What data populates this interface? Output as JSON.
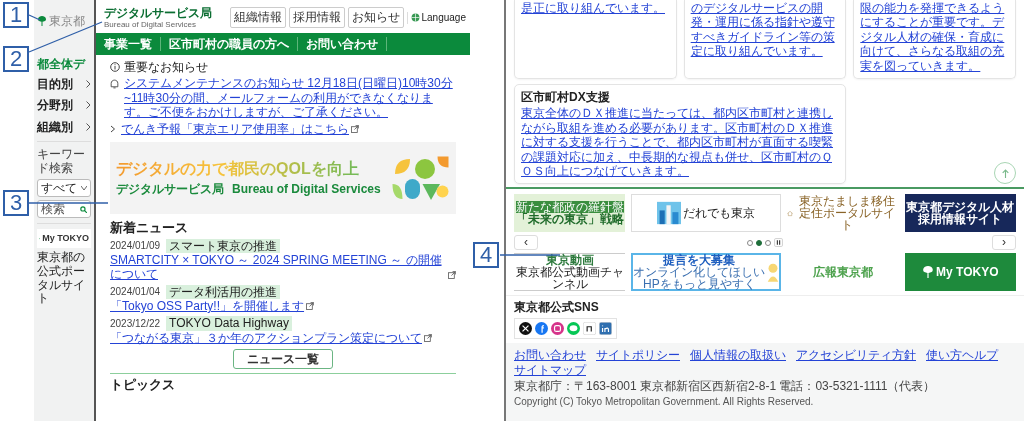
{
  "callouts": [
    {
      "label": "1"
    },
    {
      "label": "2"
    },
    {
      "label": "3"
    },
    {
      "label": "4"
    }
  ],
  "left_page": {
    "sidebar": {
      "logo": "東京都",
      "home_link": "都全体デ",
      "menu": [
        {
          "label": "目的別"
        },
        {
          "label": "分野別"
        },
        {
          "label": "組織別"
        }
      ],
      "search_label": "キーワード検索",
      "scope_select": "すべて",
      "search": {
        "placeholder": "検索"
      },
      "portal_banner": "My TOKYO",
      "portal_caption": "東京都の公式ポータルサイト"
    },
    "header": {
      "title": "デジタルサービス局",
      "subtitle": "Bureau of Digital Services",
      "links": [
        "組織情報",
        "採用情報",
        "お知らせ"
      ],
      "language": "Language"
    },
    "nav": [
      "事業一覧",
      "区市町村の職員の方へ",
      "お問い合わせ"
    ],
    "notices": {
      "heading": "重要なお知らせ",
      "items": [
        {
          "kind": "bell",
          "text": "システムメンテナンスのお知らせ 12月18日(日曜日)10時30分~11時30分の間、メールフォームの利用ができなくなります。ご不便をおかけしますが、ご了承ください。",
          "external": false
        },
        {
          "kind": "chevron",
          "text": "でんき予報「東京エリア使用率」はこちら",
          "external": true
        }
      ]
    },
    "hero": {
      "headline": "デジタルの力で都民のQOLを向上",
      "bureau": "デジタルサービス局",
      "bureau_en": "Bureau of Digital Services"
    },
    "news": {
      "heading": "新着ニュース",
      "items": [
        {
          "date": "2024/01/09",
          "tag": "スマート東京の推進",
          "title": "SMARTCITY × TOKYO ～ 2024 SPRING MEETING ～ の開催について",
          "external": true
        },
        {
          "date": "2024/01/04",
          "tag": "データ利活用の推進",
          "title": "「Tokyo OSS Party!!」を開催します",
          "external": true
        },
        {
          "date": "2023/12/22",
          "tag": "TOKYO Data Highway",
          "title": "「つながる東京」３か年のアクションプラン策定について",
          "external": true
        }
      ],
      "more_button": "ニュース一覧"
    },
    "topics_heading": "トピックス"
  },
  "right_page": {
    "cards": [
      {
        "text": "是正に取り組んでいます。"
      },
      {
        "text": "のデジタルサービスの開発・運用に係る指針や遵守すべきガイドライン等の策定に取り組んでいます。"
      },
      {
        "text": "限の能力を発揮できるようにすることが重要です。デジタル人材の確保・育成に向けて、さらなる取組の充実を図っていきます。"
      },
      {
        "title": "区市町村DX支援",
        "text": "東京全体のＤＸ推進に当たっては、都内区市町村と連携しながら取組を進める必要があります。区市町村のＤＸ推進に対する支援を行うことで、都内区市町村が直面する喫緊の課題対応に加え、中長期的な視点も併せ、区市町村のＱＯＳ向上につなげていきます。"
      }
    ],
    "banners_top": [
      {
        "kind": "strategy",
        "lines": [
          "新たな都政の羅針盤",
          "「未来の東京」戦略"
        ]
      },
      {
        "kind": "city",
        "lines": [
          "だれでも東京"
        ]
      },
      {
        "kind": "house",
        "lines": [
          "東京たましま移住定住ポータルサイト"
        ]
      },
      {
        "kind": "navy",
        "lines": [
          "東京都デジタル人材",
          "採用情報サイト"
        ]
      }
    ],
    "carousel": {
      "prev": "‹",
      "next": "›",
      "dots": [
        {
          "selected": false
        },
        {
          "selected": true
        },
        {
          "selected": false
        }
      ]
    },
    "banners_bottom": [
      {
        "kind": "video",
        "lines": [
          "東京動画",
          "東京都公式動画チャンネル"
        ]
      },
      {
        "kind": "proposal",
        "lines": [
          "提言を大募集",
          "オンライン化してほしい",
          "HPをもっと見やすく"
        ]
      },
      {
        "kind": "koho",
        "lines": [
          "広報東京都"
        ]
      },
      {
        "kind": "mytokyo",
        "lines": [
          "My TOKYO"
        ]
      }
    ],
    "sns": {
      "heading": "東京都公式SNS",
      "icons": [
        {
          "kind": "x"
        },
        {
          "kind": "facebook"
        },
        {
          "kind": "instagram"
        },
        {
          "kind": "line"
        },
        {
          "kind": "note"
        },
        {
          "kind": "linkedin"
        }
      ]
    },
    "footer": {
      "links": [
        "お問い合わせ",
        "サイトポリシー",
        "個人情報の取扱い",
        "アクセシビリティ方針",
        "使い方ヘルプ",
        "サイトマップ"
      ],
      "address": "東京都庁：〒163-8001 東京都新宿区西新宿2-8-1 電話：03-5321-1111（代表）",
      "copyright": "Copyright (C) Tokyo Metropolitan Government. All Rights Reserved."
    }
  }
}
